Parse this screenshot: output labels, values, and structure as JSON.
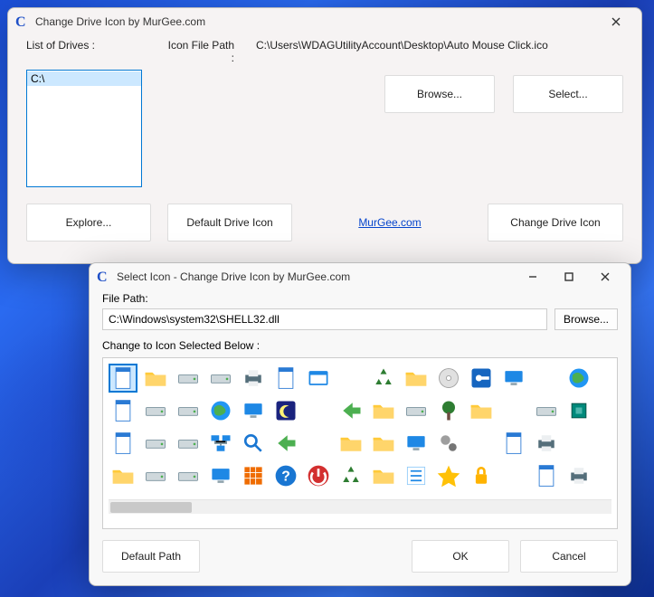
{
  "main": {
    "title": "Change Drive Icon by MurGee.com",
    "labels": {
      "drives": "List of Drives :",
      "path": "Icon File Path :"
    },
    "path_value": "C:\\Users\\WDAGUtilityAccount\\Desktop\\Auto Mouse Click.ico",
    "drives": [
      "C:\\"
    ],
    "buttons": {
      "browse": "Browse...",
      "select": "Select...",
      "explore": "Explore...",
      "default_icon": "Default Drive Icon",
      "change": "Change Drive Icon"
    },
    "link": "MurGee.com"
  },
  "select": {
    "title": "Select Icon - Change Drive Icon by MurGee.com",
    "file_path_label": "File Path:",
    "file_path": "C:\\Windows\\system32\\SHELL32.dll",
    "browse": "Browse...",
    "change_label": "Change to Icon Selected Below :",
    "buttons": {
      "default_path": "Default Path",
      "ok": "OK",
      "cancel": "Cancel"
    },
    "icons": [
      [
        "document",
        "folder",
        "drive",
        "drive-dark",
        "printer",
        "clock-doc",
        "window",
        "",
        "recycle",
        "folder-grid",
        "disc",
        "key",
        "screens",
        "",
        "magnifier-globe",
        ""
      ],
      [
        "doc-sel",
        "drive",
        "drive-net",
        "globe",
        "monitor-chart",
        "moon",
        "",
        "share-arrow",
        "folder-open",
        "drive2",
        "tree",
        "folder-y",
        "",
        "help-drive",
        "chip",
        ""
      ],
      [
        "page",
        "drive",
        "drive-stack",
        "network",
        "search",
        "arrow-green",
        "",
        "net-folder",
        "folder-a",
        "computer",
        "gears",
        "",
        "page-blank",
        "printer2",
        "",
        ""
      ],
      [
        "folder",
        "drive",
        "drive",
        "monitor",
        "grid",
        "help",
        "power",
        "recycle",
        "folder",
        "list",
        "star",
        "lock",
        "",
        "page-search",
        "printer3",
        ""
      ]
    ],
    "selected": [
      0,
      0
    ]
  }
}
